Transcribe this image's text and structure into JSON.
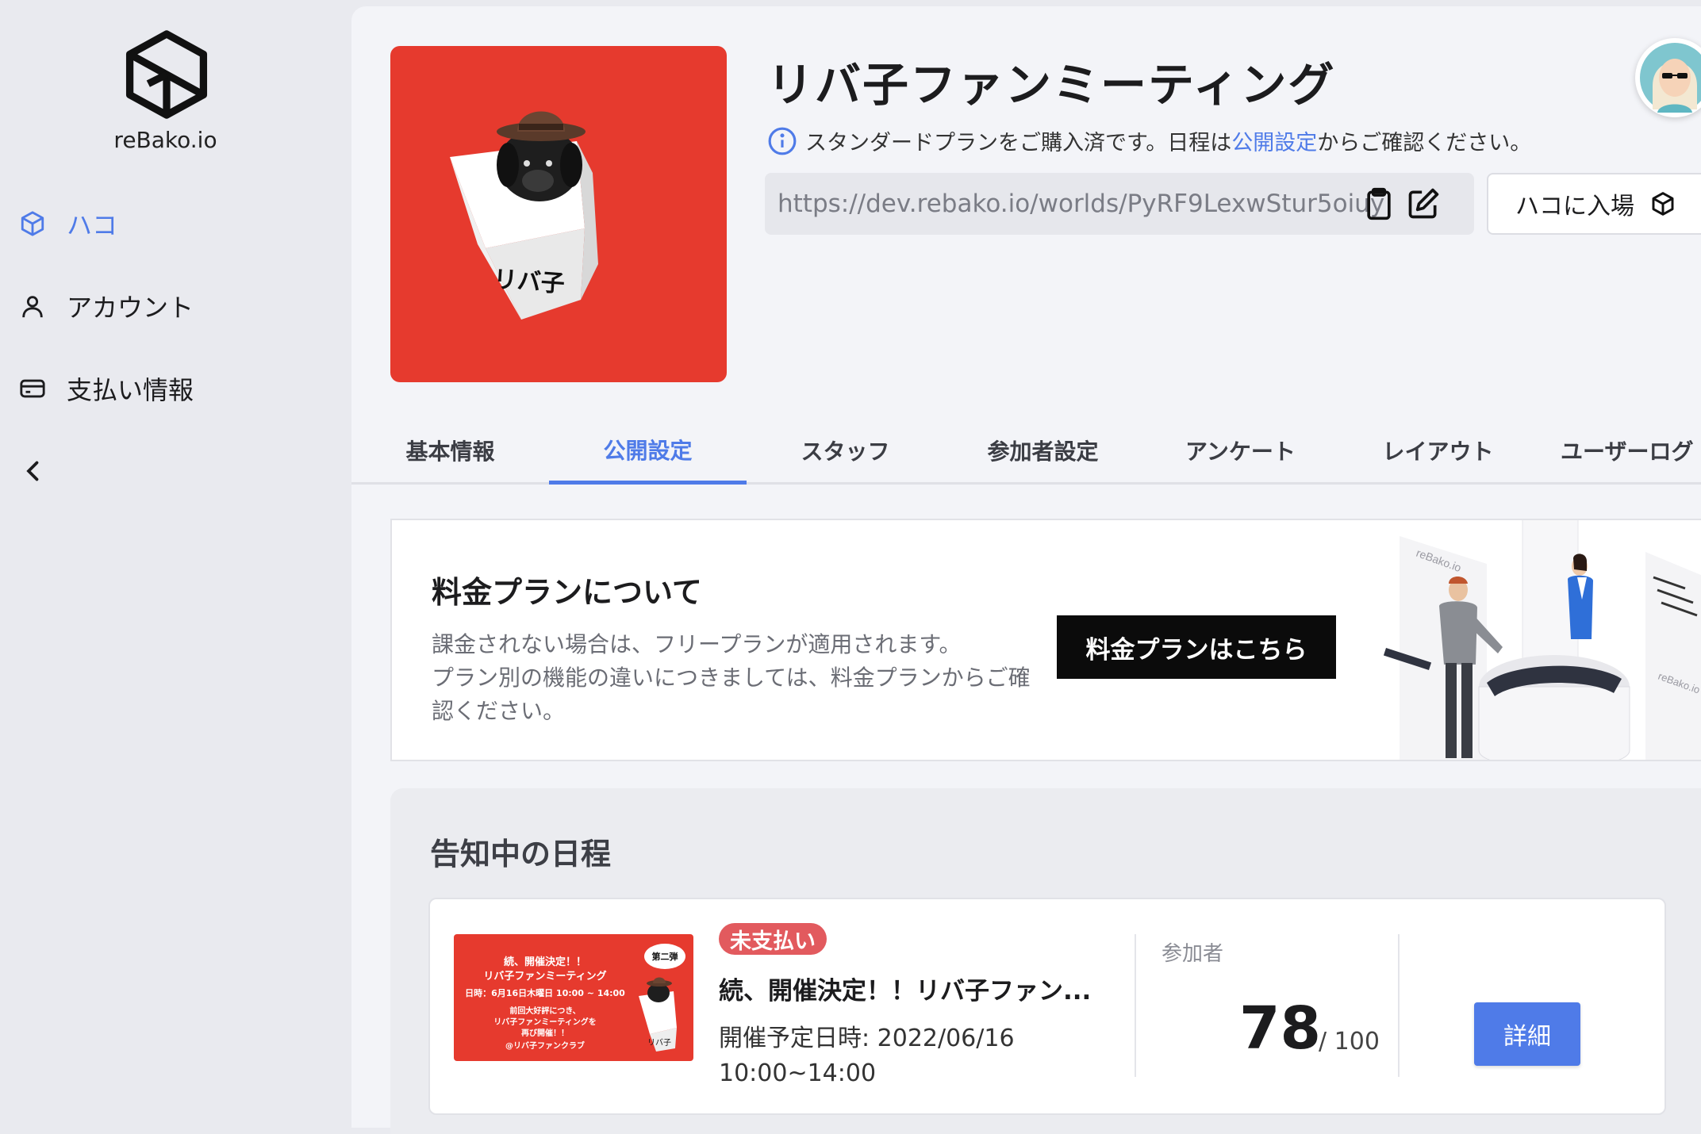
{
  "sidebar": {
    "logo_text": "reBako.io",
    "items": [
      {
        "label": "ハコ",
        "icon": "cube-icon",
        "active": true
      },
      {
        "label": "アカウント",
        "icon": "user-icon",
        "active": false
      },
      {
        "label": "支払い情報",
        "icon": "credit-card-icon",
        "active": false
      }
    ]
  },
  "header": {
    "title": "リバ子ファンミーティング",
    "cover_label": "リバ子",
    "notice_before": "スタンダードプランをご購入済です。日程は",
    "notice_link": "公開設定",
    "notice_after": "からご確認ください。",
    "url": "https://dev.rebako.io/worlds/PyRF9LexwStur5oiuy",
    "enter_label": "ハコに入場"
  },
  "tabs": [
    {
      "label": "基本情報",
      "active": false
    },
    {
      "label": "公開設定",
      "active": true
    },
    {
      "label": "スタッフ",
      "active": false
    },
    {
      "label": "参加者設定",
      "active": false
    },
    {
      "label": "アンケート",
      "active": false
    },
    {
      "label": "レイアウト",
      "active": false
    },
    {
      "label": "ユーザーログ",
      "active": false
    }
  ],
  "plan": {
    "title": "料金プランについて",
    "desc_1": "課金されない場合は、フリープランが適用されます。",
    "desc_2": "プラン別の機能の違いにつきましては、料金プランからご確認ください。",
    "button": "料金プランはこちら",
    "illus_brand": "reBako.io"
  },
  "schedule": {
    "title": "告知中の日程",
    "event": {
      "badge": "未支払い",
      "title": "続、開催決定！！リバ子ファン...",
      "date": "開催予定日時: 2022/06/16 10:00~14:00",
      "participants_label": "参加者",
      "participants": "78",
      "capacity": "/ 100",
      "detail_button": "詳細",
      "thumb": {
        "line1": "続、開催決定！！",
        "line2": "リバ子ファンミーティング",
        "line3": "日時：6月16日木曜日 10:00 ~ 14:00",
        "line4": "前回大好評につき、",
        "line5": "リバ子ファンミーティングを",
        "line6": "再び開催！！",
        "line7": "@リバ子ファンクラブ",
        "sticker": "第二弾",
        "box_label": "リバ子"
      }
    }
  },
  "colors": {
    "accent": "#4f7be8",
    "brand_red": "#e63a2e",
    "badge": "#e25a5e"
  }
}
